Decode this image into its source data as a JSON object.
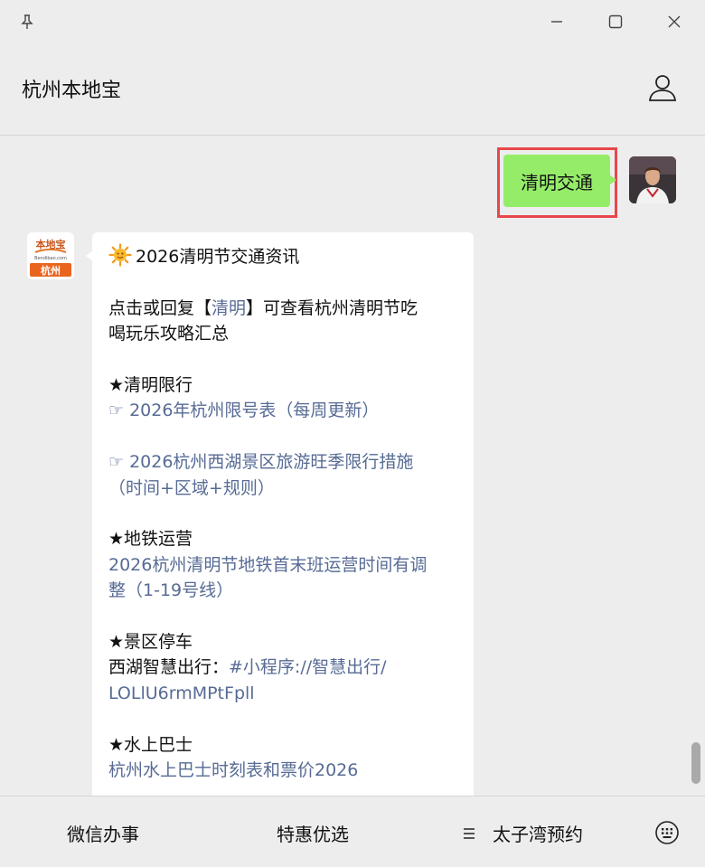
{
  "window": {
    "icons": [
      "pin-icon",
      "minimize-icon",
      "maximize-icon",
      "close-icon"
    ]
  },
  "header": {
    "title": "杭州本地宝",
    "user_icon": "user-icon"
  },
  "chat": {
    "sent_message": "清明交通",
    "highlight_color": "#e8474b",
    "sent_bubble_color": "#95ec69",
    "link_color": "#576b95",
    "bot_avatar": {
      "brand": "本地宝",
      "site": "Bendibao.com",
      "city": "杭州"
    },
    "reply": {
      "title": "2026清明节交通资讯",
      "intro_part1": "点击或回复【",
      "intro_link": "清明",
      "intro_part2": "】可查看杭州清明节吃",
      "intro_line2": "喝玩乐攻略汇总",
      "section1_heading": "★清明限行",
      "section1_link1": "☞ 2026年杭州限号表（每周更新）",
      "section1_link2_line1": "☞ 2026杭州西湖景区旅游旺季限行措施",
      "section1_link2_line2": "（时间+区域+规则）",
      "section2_heading": "★地铁运营",
      "section2_link_line1": "2026杭州清明节地铁首末班运营时间有调",
      "section2_link_line2": "整（1-19号线）",
      "section3_heading": "★景区停车",
      "section3_text": "西湖智慧出行：",
      "section3_link_line1": "#小程序://智慧出行/",
      "section3_link_line2": "LOLlU6rmMPtFpll",
      "section4_heading": "★水上巴士",
      "section4_link": "杭州水上巴士时刻表和票价2026"
    }
  },
  "bottom_menu": {
    "item1": "微信办事",
    "item2": "特惠优选",
    "item3": "太子湾预约",
    "item3_icon": "menu-lines-icon",
    "keyboard_icon": "keyboard-icon"
  }
}
